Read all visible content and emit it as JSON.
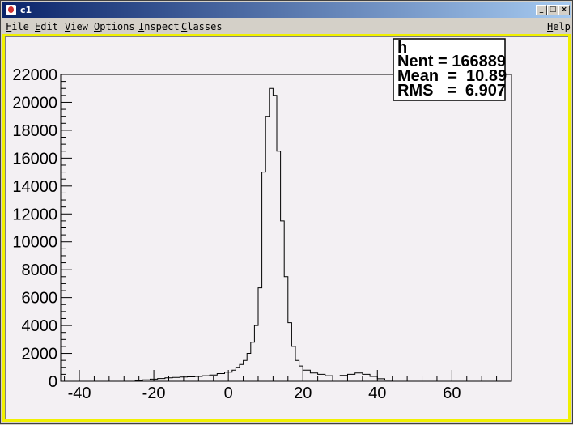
{
  "window": {
    "title": "c1",
    "buttons": {
      "minimize": "_",
      "maximize": "□",
      "close": "×"
    }
  },
  "menu": {
    "items": [
      {
        "label": "File",
        "accel": "F"
      },
      {
        "label": "Edit",
        "accel": "E"
      },
      {
        "label": "View",
        "accel": "V"
      },
      {
        "label": "Options",
        "accel": "O"
      },
      {
        "label": "Inspect",
        "accel": "I"
      },
      {
        "label": "Classes",
        "accel": "C"
      }
    ],
    "help": {
      "label": "Help",
      "accel": "H"
    }
  },
  "stats": {
    "name": "h",
    "entries": "Nent = 166889",
    "mean": "Mean  =  10.89",
    "rms": "RMS   =  6.907"
  },
  "colors": {
    "canvas_bg": "#f3f0f3",
    "frame": "#f0f000",
    "line": "#000000"
  },
  "chart_data": {
    "type": "bar",
    "style": "step-histogram",
    "xlim": [
      -45,
      76
    ],
    "ylim": [
      0,
      22000
    ],
    "xticks": [
      -40,
      -20,
      0,
      20,
      40,
      60
    ],
    "yticks": [
      0,
      2000,
      4000,
      6000,
      8000,
      10000,
      12000,
      14000,
      16000,
      18000,
      20000,
      22000
    ],
    "xlabel": "",
    "ylabel": "",
    "title": "",
    "grid": false,
    "bins": [
      {
        "x0": -45,
        "x1": -25,
        "y": 0
      },
      {
        "x0": -25,
        "x1": -23,
        "y": 50
      },
      {
        "x0": -23,
        "x1": -21,
        "y": 100
      },
      {
        "x0": -21,
        "x1": -19,
        "y": 150
      },
      {
        "x0": -19,
        "x1": -17,
        "y": 200
      },
      {
        "x0": -17,
        "x1": -15,
        "y": 250
      },
      {
        "x0": -15,
        "x1": -13,
        "y": 280
      },
      {
        "x0": -13,
        "x1": -11,
        "y": 300
      },
      {
        "x0": -11,
        "x1": -9,
        "y": 320
      },
      {
        "x0": -9,
        "x1": -7,
        "y": 350
      },
      {
        "x0": -7,
        "x1": -5,
        "y": 400
      },
      {
        "x0": -5,
        "x1": -3,
        "y": 450
      },
      {
        "x0": -3,
        "x1": -1,
        "y": 550
      },
      {
        "x0": -1,
        "x1": 1,
        "y": 650
      },
      {
        "x0": 1,
        "x1": 2,
        "y": 800
      },
      {
        "x0": 2,
        "x1": 3,
        "y": 1000
      },
      {
        "x0": 3,
        "x1": 4,
        "y": 1200
      },
      {
        "x0": 4,
        "x1": 5,
        "y": 1500
      },
      {
        "x0": 5,
        "x1": 6,
        "y": 2000
      },
      {
        "x0": 6,
        "x1": 7,
        "y": 2800
      },
      {
        "x0": 7,
        "x1": 8,
        "y": 4000
      },
      {
        "x0": 8,
        "x1": 9,
        "y": 6700
      },
      {
        "x0": 9,
        "x1": 10,
        "y": 15000
      },
      {
        "x0": 10,
        "x1": 11,
        "y": 19000
      },
      {
        "x0": 11,
        "x1": 12,
        "y": 21000
      },
      {
        "x0": 12,
        "x1": 13,
        "y": 20500
      },
      {
        "x0": 13,
        "x1": 14,
        "y": 16500
      },
      {
        "x0": 14,
        "x1": 15,
        "y": 11500
      },
      {
        "x0": 15,
        "x1": 16,
        "y": 7500
      },
      {
        "x0": 16,
        "x1": 17,
        "y": 4200
      },
      {
        "x0": 17,
        "x1": 18,
        "y": 2500
      },
      {
        "x0": 18,
        "x1": 19,
        "y": 1500
      },
      {
        "x0": 19,
        "x1": 20,
        "y": 1100
      },
      {
        "x0": 20,
        "x1": 22,
        "y": 800
      },
      {
        "x0": 22,
        "x1": 24,
        "y": 600
      },
      {
        "x0": 24,
        "x1": 26,
        "y": 500
      },
      {
        "x0": 26,
        "x1": 28,
        "y": 400
      },
      {
        "x0": 28,
        "x1": 30,
        "y": 380
      },
      {
        "x0": 30,
        "x1": 32,
        "y": 420
      },
      {
        "x0": 32,
        "x1": 34,
        "y": 500
      },
      {
        "x0": 34,
        "x1": 36,
        "y": 600
      },
      {
        "x0": 36,
        "x1": 38,
        "y": 500
      },
      {
        "x0": 38,
        "x1": 40,
        "y": 350
      },
      {
        "x0": 40,
        "x1": 42,
        "y": 180
      },
      {
        "x0": 42,
        "x1": 44,
        "y": 80
      },
      {
        "x0": 44,
        "x1": 76,
        "y": 0
      }
    ]
  }
}
